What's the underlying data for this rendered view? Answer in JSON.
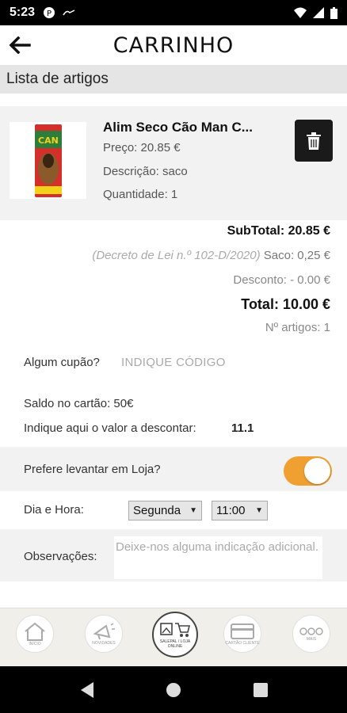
{
  "status_bar": {
    "time": "5:23"
  },
  "header": {
    "title": "CARRINHO"
  },
  "section": {
    "title": "Lista de artigos"
  },
  "item": {
    "name": "Alim Seco Cão Man C...",
    "price": "Preço: 20.85 €",
    "description": "Descrição: saco",
    "quantity": "Quantidade: 1",
    "image_label": "CAN"
  },
  "totals": {
    "subtotal": "SubTotal: 20.85 €",
    "decreto": "(Decreto de Lei n.º 102-D/2020)",
    "saco": "Saco: 0,25 €",
    "desconto": "Desconto: - 0.00 €",
    "total": "Total: 10.00 €",
    "artigos": "Nº artigos: 1"
  },
  "coupon": {
    "label": "Algum cupão?",
    "placeholder": "INDIQUE CÓDIGO"
  },
  "balance": {
    "saldo": "Saldo no cartão: 50€",
    "discount_label": "Indique aqui o valor a descontar:",
    "discount_value": "11.1"
  },
  "pickup": {
    "label": "Prefere levantar em Loja?",
    "enabled": true
  },
  "schedule": {
    "label": "Dia e Hora:",
    "day": "Segunda",
    "time": "11:00"
  },
  "observations": {
    "label": "Observações:",
    "placeholder": "Deixe-nos alguma indicação adicional."
  },
  "bottom_nav": [
    {
      "label": "INÍCIO",
      "icon": "home-icon"
    },
    {
      "label": "NOVIDADES",
      "icon": "megaphone-icon"
    },
    {
      "label": "SALEPAL / LOJA ONLINE",
      "icon": "shop-icon"
    },
    {
      "label": "CARTÃO CLIENTE",
      "icon": "card-icon"
    },
    {
      "label": "MAIS",
      "icon": "more-icon"
    }
  ],
  "colors": {
    "accent": "#f0a030",
    "dark": "#1a1a1a",
    "band": "#f2f2f2"
  }
}
